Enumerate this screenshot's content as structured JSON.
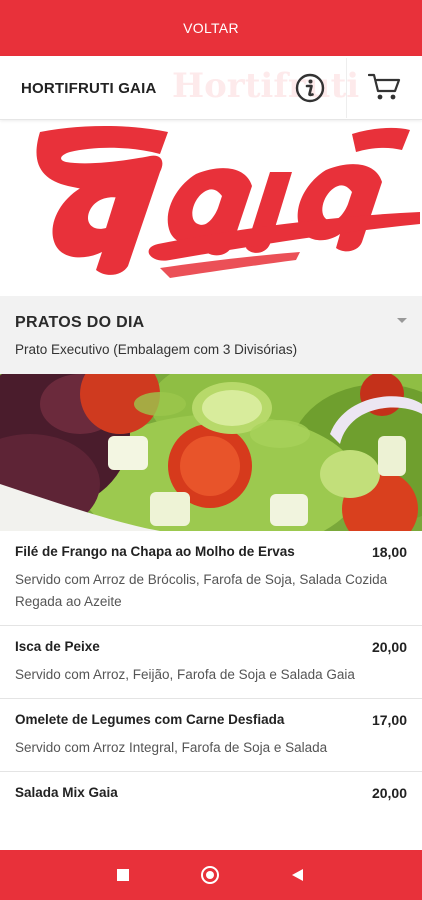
{
  "topbar": {
    "back_label": "VOLTAR"
  },
  "header": {
    "store_name": "HORTIFRUTI GAIA",
    "watermark_text": "Hortifruti"
  },
  "brand": {
    "logo_text": "Gaia",
    "accent_color": "#e8313a"
  },
  "section": {
    "title": "PRATOS DO DIA",
    "subtitle": "Prato Executivo (Embalagem com 3 Divisórias)"
  },
  "menu_items": [
    {
      "name": "Filé de Frango na Chapa ao Molho de Ervas",
      "price": "18,00",
      "description": "Servido com Arroz de Brócolis, Farofa de Soja, Salada Cozida Regada ao Azeite"
    },
    {
      "name": "Isca de Peixe",
      "price": "20,00",
      "description": "Servido com Arroz, Feijão, Farofa de Soja e Salada Gaia"
    },
    {
      "name": "Omelete de Legumes com Carne Desfiada",
      "price": "17,00",
      "description": "Servido com Arroz Integral, Farofa de Soja e Salada"
    },
    {
      "name": "Salada Mix Gaia",
      "price": "20,00",
      "description": ""
    }
  ],
  "icons": {
    "info": "info-icon",
    "cart": "cart-icon",
    "caret": "chevron-down-icon",
    "nav_recents": "square-icon",
    "nav_home": "circle-icon",
    "nav_back": "triangle-back-icon"
  }
}
